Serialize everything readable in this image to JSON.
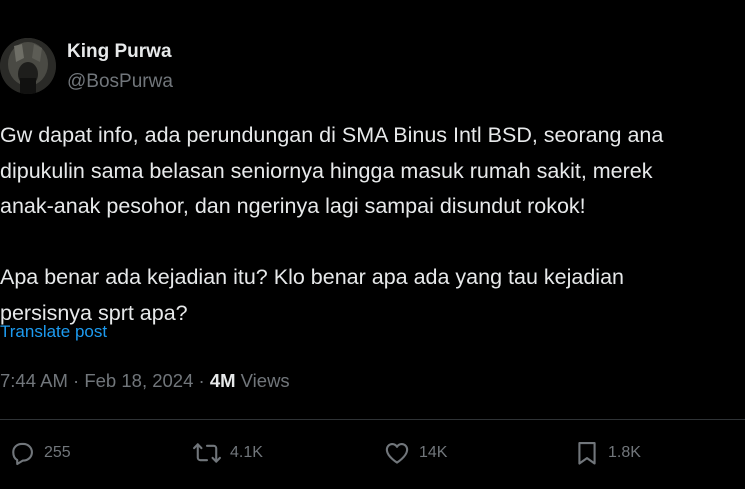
{
  "author": {
    "name": "King Purwa",
    "handle": "@BosPurwa"
  },
  "tweet": {
    "lines": [
      "Gw dapat info, ada perundungan di SMA Binus Intl BSD, seorang ana",
      "dipukulin sama belasan seniornya hingga masuk rumah sakit, merek",
      "anak-anak pesohor, dan ngerinya lagi sampai disundut rokok!",
      "Apa benar ada kejadian itu? Klo benar apa ada yang tau kejadian",
      "persisnya sprt apa?"
    ],
    "translate_label": "Translate post"
  },
  "meta": {
    "time": "7:44 AM",
    "separator": "·",
    "date": "Feb 18, 2024",
    "views_count": "4M",
    "views_label": "Views"
  },
  "actions": {
    "reply_count": "255",
    "repost_count": "4.1K",
    "like_count": "14K",
    "bookmark_count": "1.8K"
  },
  "colors": {
    "background": "#000000",
    "text": "#e7e9ea",
    "muted": "#71767b",
    "link": "#1d9bf0",
    "divider": "#2f3336"
  },
  "icons": {
    "avatar": "avatar-photo",
    "reply": "reply-bubble-icon",
    "repost": "repost-arrows-icon",
    "like": "heart-icon",
    "bookmark": "bookmark-icon"
  }
}
